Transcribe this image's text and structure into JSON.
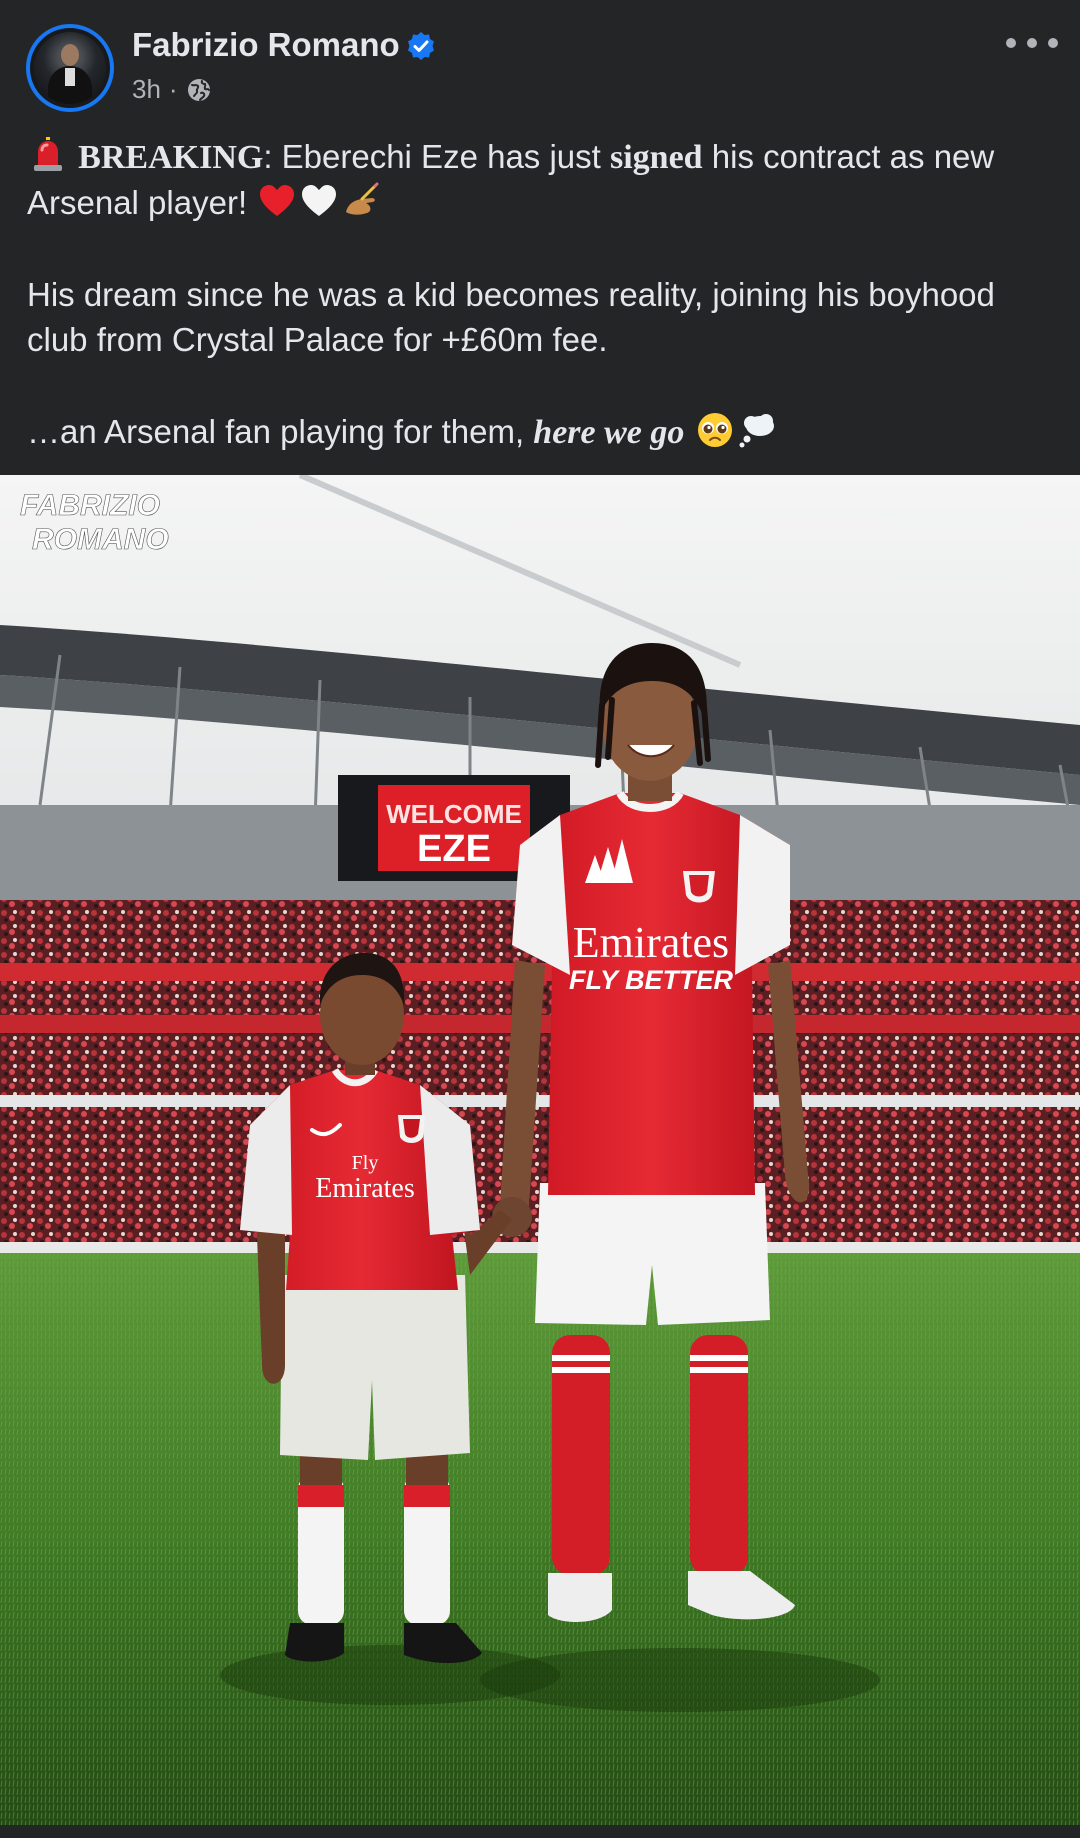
{
  "post": {
    "author": "Fabrizio Romano",
    "time": "3h",
    "separator": "·",
    "privacy_icon": "globe-icon",
    "verified_icon": "verified-badge-icon",
    "more_icon": "more-options-icon",
    "text": {
      "breaking_label": "BREAKING",
      "line1_a": ": Eberechi Eze has just ",
      "signed": "signed",
      "line1_b": " his contract as new Arsenal player!",
      "para2": "His dream since he was a kid becomes reality, joining his boyhood club from Crystal Palace for +£60m fee.",
      "para3_a": "…an Arsenal fan playing for them, ",
      "here_we_go": "here we go"
    }
  },
  "image": {
    "watermark_line1": "FABRIZIO",
    "watermark_line2": "ROMANO",
    "scoreboard_line1": "WELCOME",
    "scoreboard_line2": "EZE",
    "kid_shirt_line1": "Fly",
    "kid_shirt_line2": "Emirates",
    "player_shirt_line1": "Emirates",
    "player_shirt_line2": "FLY BETTER"
  },
  "colors": {
    "background": "#242526",
    "text": "#e4e6eb",
    "secondary": "#b0b3b8",
    "accent": "#1877f2",
    "arsenal_red": "#d9202a"
  }
}
